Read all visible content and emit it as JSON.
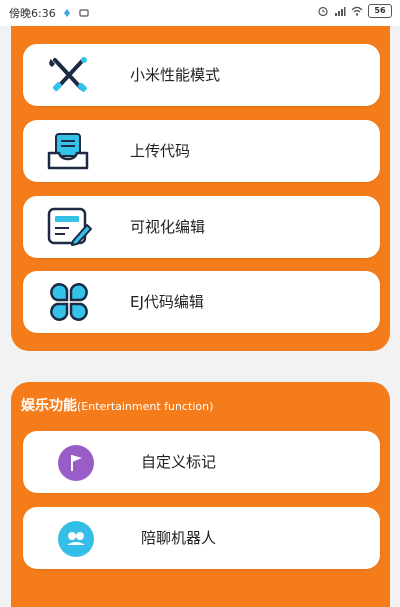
{
  "status_bar": {
    "time": "傍晚6:36",
    "battery": "56"
  },
  "tools_panel": {
    "items": [
      {
        "label": "小米性能模式",
        "icon": "tools-icon"
      },
      {
        "label": "上传代码",
        "icon": "upload-tray-icon"
      },
      {
        "label": "可视化编辑",
        "icon": "edit-document-icon"
      },
      {
        "label": "EJ代码编辑",
        "icon": "four-petal-icon"
      }
    ]
  },
  "entertainment_panel": {
    "title": "娱乐功能",
    "subtitle": "(Entertainment function)",
    "items": [
      {
        "label": "自定义标记",
        "icon": "flag-icon"
      },
      {
        "label": "陪聊机器人",
        "icon": "robot-chat-icon"
      }
    ]
  },
  "colors": {
    "accent": "#f57c1a",
    "icon_dark": "#1d2a44",
    "icon_cyan": "#33c3e8",
    "flag_circle": "#9a5cc6",
    "robot_circle": "#35bfe8"
  }
}
